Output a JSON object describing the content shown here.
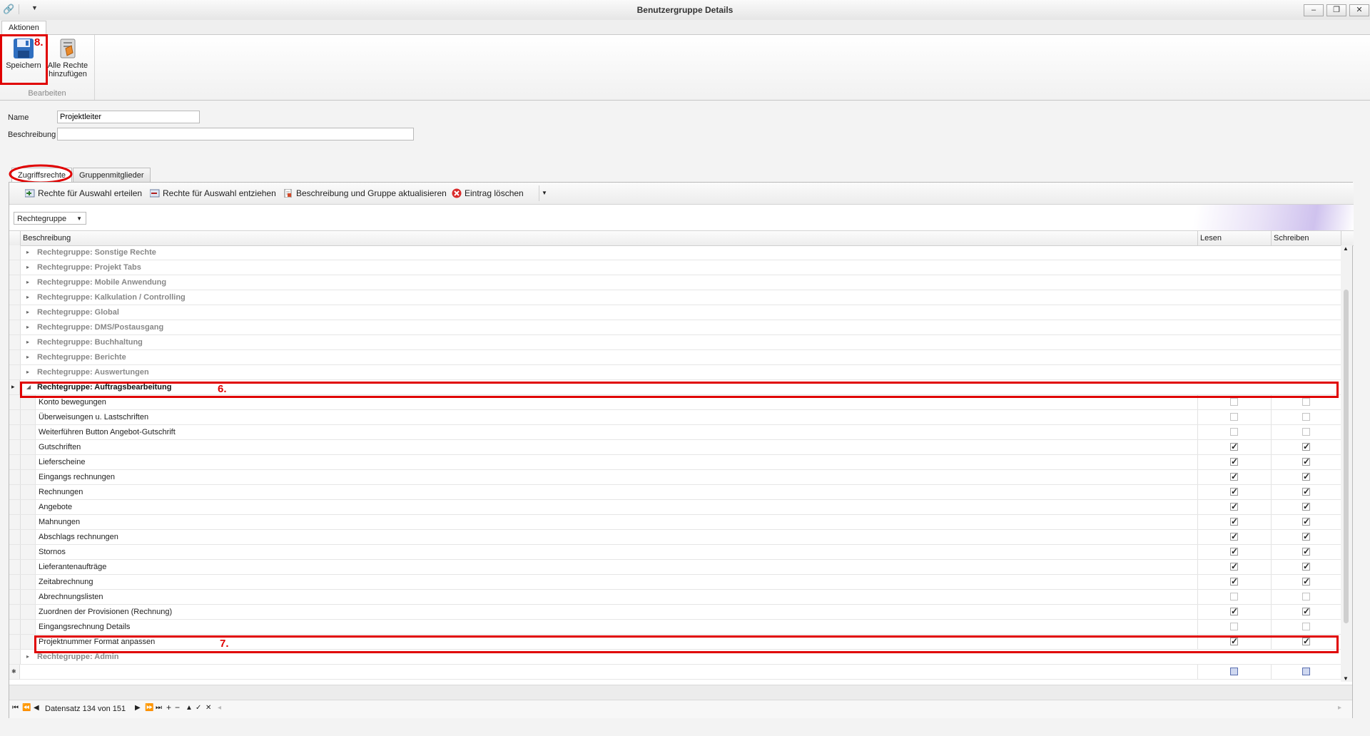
{
  "window": {
    "title": "Benutzergruppe Details",
    "minimize": "–",
    "restore": "❐",
    "close": "✕"
  },
  "ribbon": {
    "tab": "Aktionen",
    "group_label": "Bearbeiten",
    "save_label": "Speichern",
    "add_all_label_1": "Alle Rechte",
    "add_all_label_2": "hinzufügen"
  },
  "annotations": {
    "n6": "6.",
    "n7": "7.",
    "n8": "8."
  },
  "form": {
    "name_label": "Name",
    "name_value": "Projektleiter",
    "desc_label": "Beschreibung",
    "desc_value": ""
  },
  "tabs": {
    "access": "Zugriffsrechte",
    "members": "Gruppenmitglieder"
  },
  "toolbar": {
    "grant": "Rechte für Auswahl erteilen",
    "revoke": "Rechte für Auswahl entziehen",
    "update": "Beschreibung und Gruppe aktualisieren",
    "delete": "Eintrag löschen"
  },
  "grid": {
    "group_by": "Rechtegruppe",
    "col_desc": "Beschreibung",
    "col_read": "Lesen",
    "col_write": "Schreiben",
    "groups_before": [
      "Rechtegruppe: Sonstige Rechte",
      "Rechtegruppe: Projekt Tabs",
      "Rechtegruppe: Mobile Anwendung",
      "Rechtegruppe: Kalkulation / Controlling",
      "Rechtegruppe: Global",
      "Rechtegruppe: DMS/Postausgang",
      "Rechtegruppe: Buchhaltung",
      "Rechtegruppe: Berichte",
      "Rechtegruppe: Auswertungen"
    ],
    "expanded_group": "Rechtegruppe: Auftragsbearbeitung",
    "items": [
      {
        "label": "Konto bewegungen",
        "read": false,
        "write": false
      },
      {
        "label": "Überweisungen u. Lastschriften",
        "read": false,
        "write": false
      },
      {
        "label": "Weiterführen Button Angebot-Gutschrift",
        "read": false,
        "write": false
      },
      {
        "label": "Gutschriften",
        "read": true,
        "write": true
      },
      {
        "label": "Lieferscheine",
        "read": true,
        "write": true
      },
      {
        "label": "Eingangs rechnungen",
        "read": true,
        "write": true
      },
      {
        "label": "Rechnungen",
        "read": true,
        "write": true
      },
      {
        "label": "Angebote",
        "read": true,
        "write": true
      },
      {
        "label": "Mahnungen",
        "read": true,
        "write": true
      },
      {
        "label": "Abschlags rechnungen",
        "read": true,
        "write": true
      },
      {
        "label": "Stornos",
        "read": true,
        "write": true
      },
      {
        "label": "Lieferantenaufträge",
        "read": true,
        "write": true
      },
      {
        "label": "Zeitabrechnung",
        "read": true,
        "write": true
      },
      {
        "label": "Abrechnungslisten",
        "read": false,
        "write": false
      },
      {
        "label": "Zuordnen der Provisionen (Rechnung)",
        "read": true,
        "write": true
      },
      {
        "label": "Eingangsrechnung Details",
        "read": false,
        "write": false
      },
      {
        "label": "Projektnummer Format anpassen",
        "read": true,
        "write": true
      }
    ],
    "groups_after": [
      "Rechtegruppe: Admin"
    ],
    "new_row_marker": "✱"
  },
  "navigator": {
    "record_text": "Datensatz 134 von 151"
  }
}
